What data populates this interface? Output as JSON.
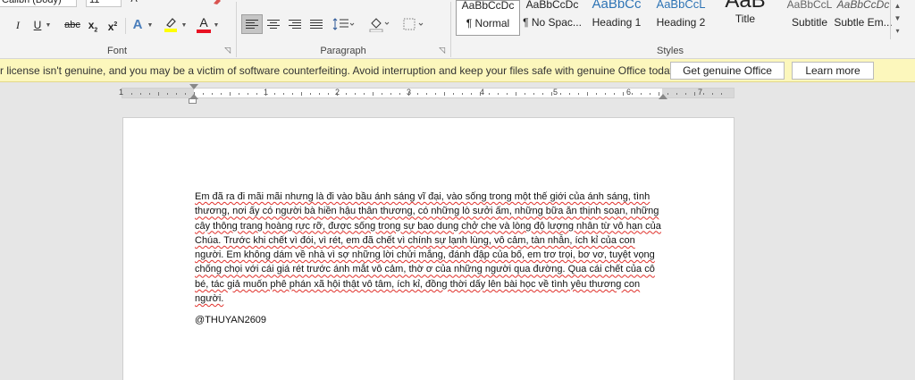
{
  "font_group": {
    "font_name": "Calibri (Body)",
    "font_size": "11",
    "label": "Font",
    "buttons": [
      "I",
      "U",
      "abc",
      "x",
      "2",
      "x",
      "2",
      "A",
      "A"
    ]
  },
  "paragraph_group": {
    "label": "Paragraph"
  },
  "styles_group": {
    "label": "Styles",
    "styles": [
      {
        "sample": "AaBbCcDc",
        "name": "¶ Normal"
      },
      {
        "sample": "AaBbCcDc",
        "name": "¶ No Spac..."
      },
      {
        "sample": "AaBbCc",
        "name": "Heading 1"
      },
      {
        "sample": "AaBbCcL",
        "name": "Heading 2"
      },
      {
        "sample": "AaB",
        "name": "Title"
      },
      {
        "sample": "AaBbCcL",
        "name": "Subtitle"
      },
      {
        "sample": "AaBbCcDc",
        "name": "Subtle Em..."
      }
    ]
  },
  "message_bar": {
    "text": "r license isn't genuine, and you may be a victim of software counterfeiting. Avoid interruption and keep your files safe with genuine Office today.",
    "primary_button": "Get genuine Office",
    "secondary_button": "Learn more"
  },
  "ruler": {
    "numbers": [
      "1",
      "1",
      "2",
      "3",
      "4",
      "5",
      "6",
      "7"
    ]
  },
  "document": {
    "paragraph": "Em đã ra đi mãi mãi nhưng là  đi vào bầu ánh sáng vĩ đại, vào sống trong một thế giới của ánh sáng, tình thương, nơi ấy có người bà hiền hậu thân thương, có những lò sưởi ấm, những bữa ăn thịnh soạn, những cây thông trang hoàng rực rỡ, được sống trong sự bao dung chở che và lòng độ lượng nhân từ vô hạn của Chúa.  Trước khi chết vì đói, vì rét, em đã chết vì chính sự lạnh lùng, vô cảm, tàn nhẫn, ích kỉ của con người.  Em không dám về nhà vì sợ những lời chửi mắng, đánh đập của bố, em trơ trọi, bơ vơ, tuyệt vọng chống chọi với cái giá rét trước ánh mắt vô cảm, thờ ơ của những người qua đường. Qua cái chết của cô bé, tác giả muốn phê phán xã hội thật vô tâm, ích kỉ, đồng thời dấy lên bài học về tình yêu thương con người.",
    "signature": "@THUYAN2609"
  },
  "colors": {
    "highlight": "#ffff00",
    "font_color": "#e81123",
    "message_bar": "#fcf7bc"
  }
}
